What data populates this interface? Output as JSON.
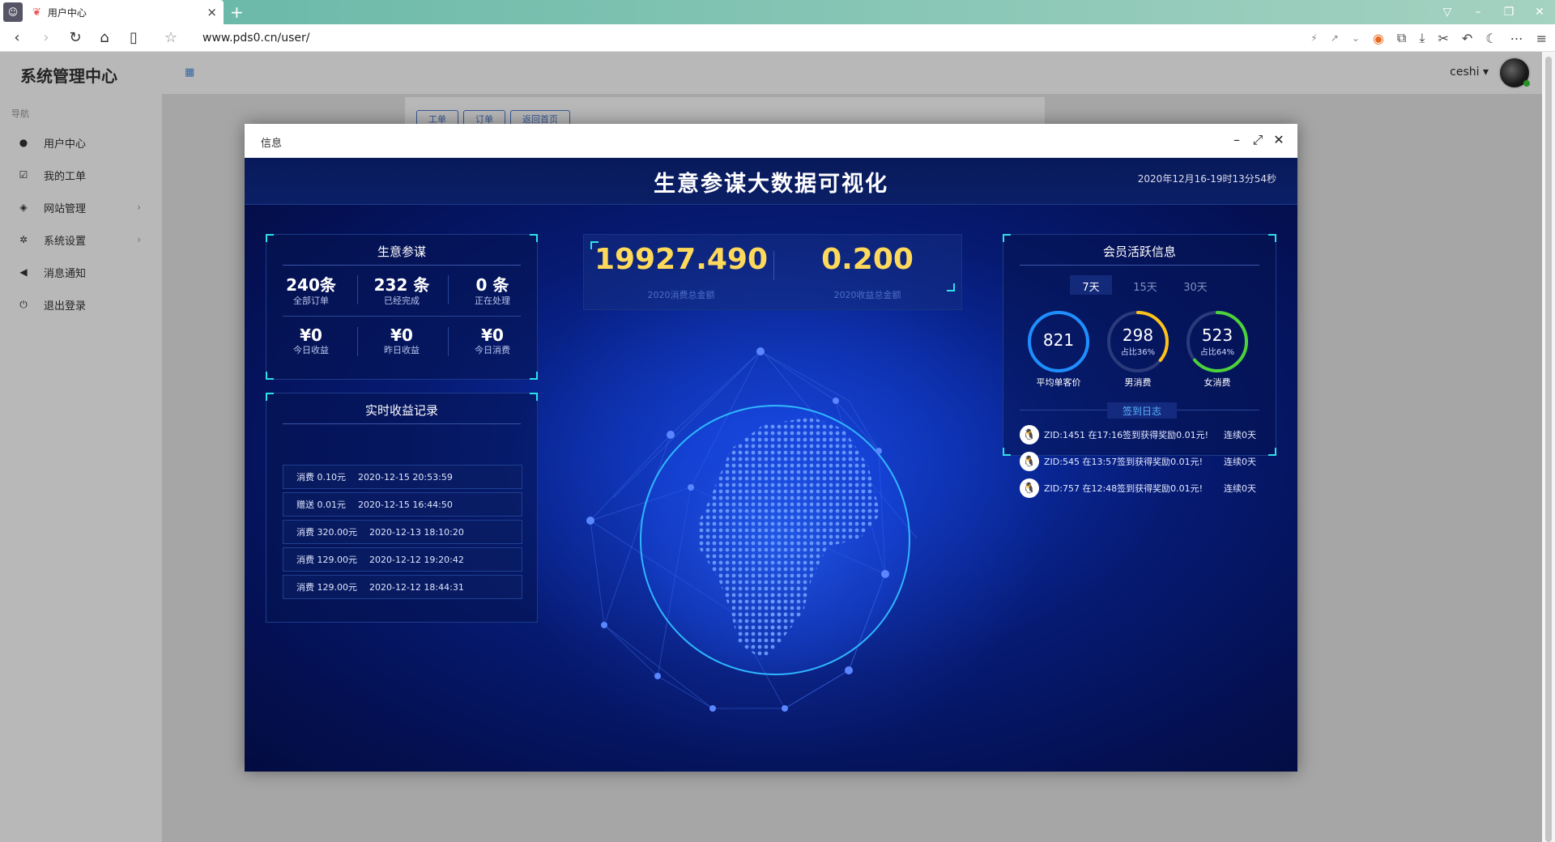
{
  "browser": {
    "tab_title": "用户中心",
    "url": "www.pds0.cn/user/"
  },
  "sidebar": {
    "brand": "系统管理中心",
    "nav_header": "导航",
    "items": [
      {
        "label": "用户中心",
        "icon": "user-icon"
      },
      {
        "label": "我的工单",
        "icon": "checkbox-icon"
      },
      {
        "label": "网站管理",
        "icon": "cube-icon",
        "has_children": true
      },
      {
        "label": "系统设置",
        "icon": "gear-icon",
        "has_children": true
      },
      {
        "label": "消息通知",
        "icon": "megaphone-icon"
      },
      {
        "label": "退出登录",
        "icon": "power-icon"
      }
    ]
  },
  "topbar": {
    "username": "ceshi"
  },
  "background_buttons": [
    "工单",
    "订单",
    "返回首页"
  ],
  "modal": {
    "title": "信息"
  },
  "dashboard": {
    "title": "生意参谋大数据可视化",
    "datetime": "2020年12月16-19时13分54秒",
    "business": {
      "title": "生意参谋",
      "row1": [
        {
          "value": "240条",
          "label": "全部订单"
        },
        {
          "value": "232 条",
          "label": "已经完成"
        },
        {
          "value": "0 条",
          "label": "正在处理"
        }
      ],
      "row2": [
        {
          "value": "¥0",
          "label": "今日收益"
        },
        {
          "value": "¥0",
          "label": "昨日收益"
        },
        {
          "value": "¥0",
          "label": "今日消费"
        }
      ]
    },
    "totals": [
      {
        "value": "19927.490",
        "label": "2020消费总金额"
      },
      {
        "value": "0.200",
        "label": "2020收益总金额"
      }
    ],
    "records": {
      "title": "实时收益记录",
      "items": [
        {
          "type": "消费 0.10元",
          "time": "2020-12-15 20:53:59"
        },
        {
          "type": "赠送 0.01元",
          "time": "2020-12-15 16:44:50"
        },
        {
          "type": "消费 320.00元",
          "time": "2020-12-13 18:10:20"
        },
        {
          "type": "消费 129.00元",
          "time": "2020-12-12 19:20:42"
        },
        {
          "type": "消费 129.00元",
          "time": "2020-12-12 18:44:31"
        }
      ]
    },
    "members": {
      "title": "会员活跃信息",
      "tabs": [
        "7天",
        "15天",
        "30天"
      ],
      "active_tab": "7天",
      "rings": [
        {
          "value": "821",
          "sub": "",
          "label": "平均单客价",
          "fraction": 1.0,
          "color": "#1e8fff"
        },
        {
          "value": "298",
          "sub": "占比36%",
          "label": "男消费",
          "fraction": 0.36,
          "color": "#ffc21a"
        },
        {
          "value": "523",
          "sub": "占比64%",
          "label": "女消费",
          "fraction": 0.64,
          "color": "#4cd23a"
        }
      ],
      "sign_title": "签到日志",
      "logs": [
        {
          "text": "ZID:1451 在17:16签到获得奖励0.01元!",
          "days": "连续0天"
        },
        {
          "text": "ZID:545 在13:57签到获得奖励0.01元!",
          "days": "连续0天"
        },
        {
          "text": "ZID:757 在12:48签到获得奖励0.01元!",
          "days": "连续0天"
        }
      ]
    }
  }
}
